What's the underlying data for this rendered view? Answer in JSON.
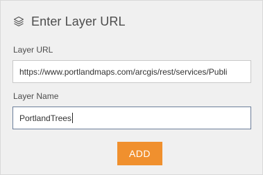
{
  "header": {
    "icon": "layers-icon",
    "title": "Enter Layer URL"
  },
  "fields": {
    "layer_url": {
      "label": "Layer URL",
      "value": "https://www.portlandmaps.com/arcgis/rest/services/Publi"
    },
    "layer_name": {
      "label": "Layer Name",
      "value": "PortlandTrees"
    }
  },
  "actions": {
    "add_label": "ADD"
  },
  "colors": {
    "panel_bg": "#f0f0f0",
    "button_bg": "#f0902e",
    "text": "#4c4c4c"
  }
}
